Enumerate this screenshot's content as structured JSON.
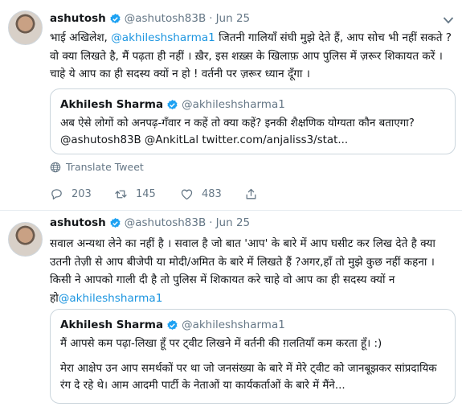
{
  "tweets": [
    {
      "author_name": "ashutosh",
      "handle": "@ashutosh83B",
      "dot": "·",
      "date": "Jun 25",
      "text_pre": "भाई अखिलेश, ",
      "text_mention": "@akhileshsharma1",
      "text_post": " जितनी गालियाँ संघी मुझे देते हैं, आप सोच भी नहीं सकते ? वो क्या लिखते है, मैं पढ़ता ही नहीं । ख़ैर, इस शख़्स के खिलाफ़ आप पुलिस में ज़रूर शिकायत करें । चाहे ये आप का ही सदस्य क्यों न हो ! वर्तनी पर ज़रूर ध्यान दूँगा ।",
      "quote": {
        "author_name": "Akhilesh Sharma",
        "handle": "@akhileshsharma1",
        "text": "अब ऐसे लोगों को अनपढ़-गँवार न कहें तो क्या कहें? इनकी शैक्षणिक योग्यता कौन बताएगा? @ashutosh83B @AnkitLal twitter.com/anjaliss3/stat..."
      },
      "translate_label": "Translate Tweet",
      "counts": {
        "replies": "203",
        "retweets": "145",
        "likes": "483"
      }
    },
    {
      "author_name": "ashutosh",
      "handle": "@ashutosh83B",
      "dot": "·",
      "date": "Jun 25",
      "text_pre": "सवाल अन्यथा लेने का नहीं है । सवाल है जो बात 'आप' के बारे में आप घसीट कर लिख देते है क्या उतनी तेज़ी से आप बीजेपी या मोदी/अमित के बारे में लिखते हैं ?अगर,हाँ तो मुझे कुछ नहीं कहना । किसी ने आपको गाली दी है तो पुलिस में शिकायत करे चाहे वो आप का ही सदस्य क्यों न हो",
      "text_mention": "@akhileshsharma1",
      "text_post": "",
      "quote": {
        "author_name": "Akhilesh Sharma",
        "handle": "@akhileshsharma1",
        "text": "मैं आपसे कम पढ़ा-लिखा हूँ पर ट्वीट लिखने में वर्तनी की ग़लतियाँ कम करता हूँ। :)",
        "text2": "मेरा आक्षेप उन आप समर्थकों पर था जो जनसंख्या के बारे में मेरे ट्वीट को जानबूझकर सांप्रदायिक रंग दे रहे थे। आम आदमी पार्टी के नेताओं या कार्यकर्ताओं के बारे में मैंने..."
      }
    }
  ],
  "colors": {
    "link": "#1b95e0",
    "verified": "#1da1f2",
    "muted": "#657786",
    "border": "#ccd6dd"
  },
  "icons": [
    "verified-badge-icon",
    "chevron-down-icon",
    "globe-icon",
    "reply-icon",
    "retweet-icon",
    "like-icon",
    "share-icon"
  ]
}
